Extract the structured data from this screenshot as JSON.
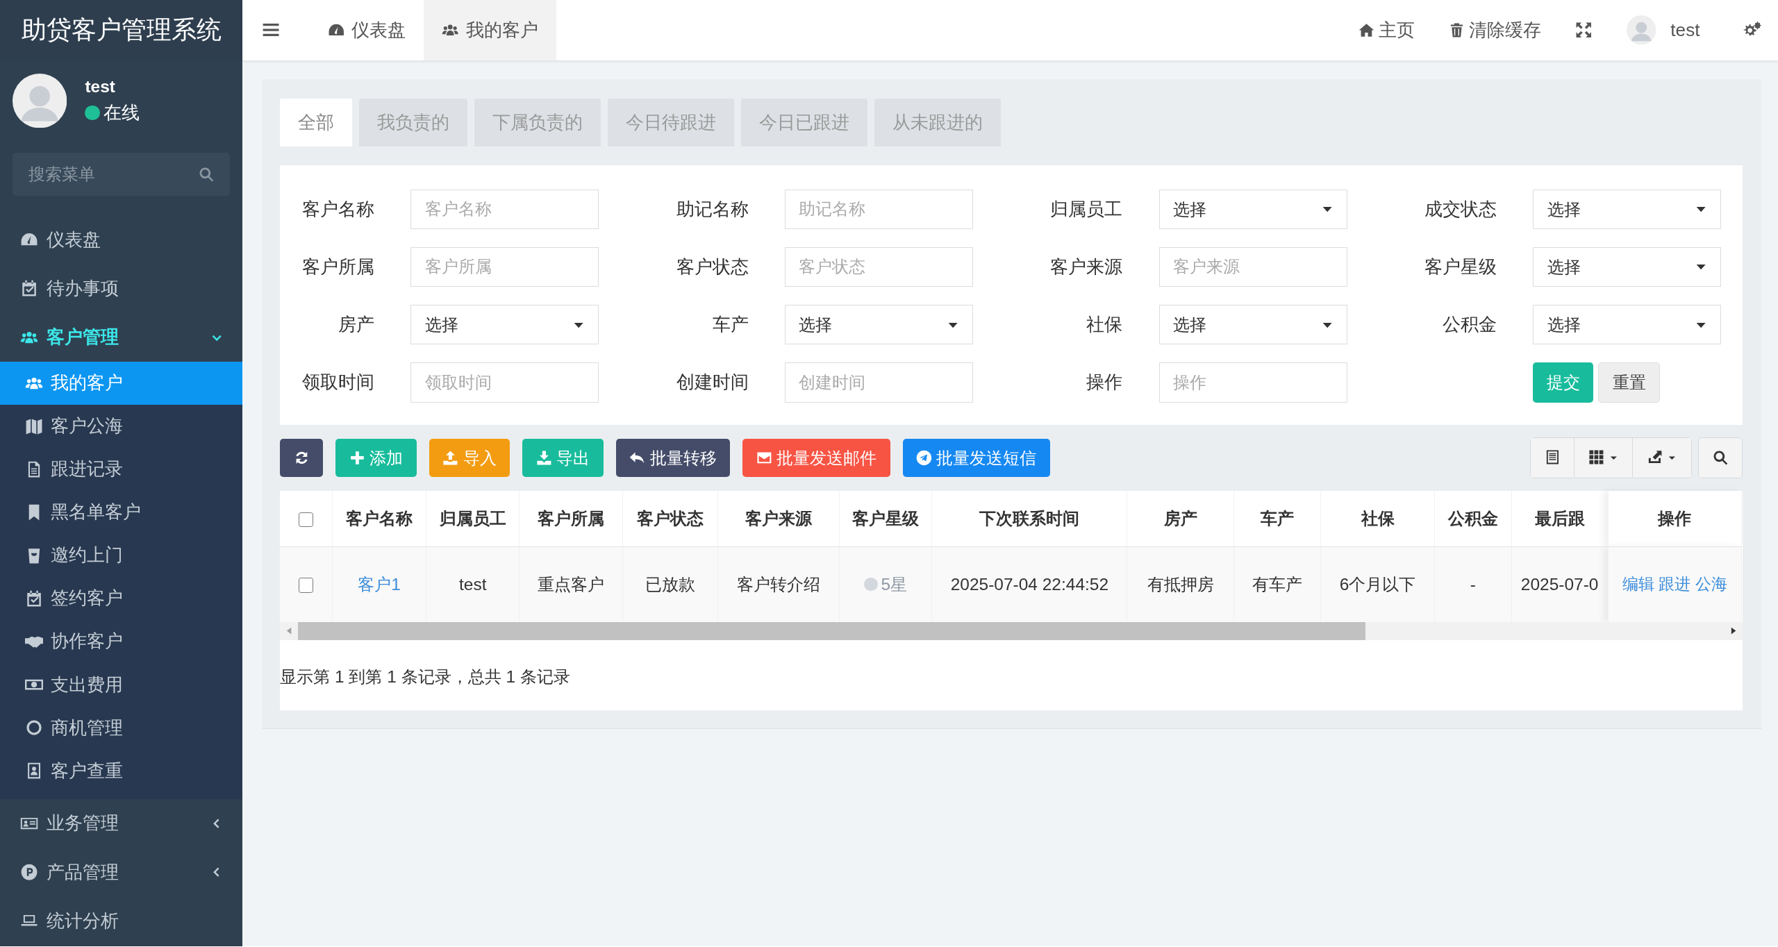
{
  "app_title": "助贷客户管理系统",
  "user": {
    "name": "test",
    "status": "在线",
    "online": true
  },
  "sidebar": {
    "search_placeholder": "搜索菜单",
    "items": [
      {
        "label": "仪表盘",
        "selected": false
      },
      {
        "label": "待办事项",
        "selected": false
      },
      {
        "label": "客户管理",
        "selected": true,
        "expanded": true,
        "children": [
          {
            "label": "我的客户",
            "selected": true
          },
          {
            "label": "客户公海",
            "selected": false
          },
          {
            "label": "跟进记录",
            "selected": false
          },
          {
            "label": "黑名单客户",
            "selected": false
          },
          {
            "label": "邀约上门",
            "selected": false
          },
          {
            "label": "签约客户",
            "selected": false
          },
          {
            "label": "协作客户",
            "selected": false
          },
          {
            "label": "支出费用",
            "selected": false
          },
          {
            "label": "商机管理",
            "selected": false
          },
          {
            "label": "客户查重",
            "selected": false
          }
        ]
      },
      {
        "label": "业务管理",
        "selected": false,
        "expanded": false
      },
      {
        "label": "产品管理",
        "selected": false,
        "expanded": false
      },
      {
        "label": "统计分析",
        "selected": false
      }
    ]
  },
  "topbar": {
    "tabs": [
      {
        "label": "仪表盘",
        "selected": false
      },
      {
        "label": "我的客户",
        "selected": true
      }
    ],
    "links": [
      "主页",
      "清除缓存"
    ],
    "user": "test"
  },
  "filter_tabs": [
    {
      "label": "全部",
      "selected": true
    },
    {
      "label": "我负责的",
      "selected": false
    },
    {
      "label": "下属负责的",
      "selected": false
    },
    {
      "label": "今日待跟进",
      "selected": false
    },
    {
      "label": "今日已跟进",
      "selected": false
    },
    {
      "label": "从未跟进的",
      "selected": false
    }
  ],
  "form": {
    "fields": [
      {
        "label": "客户名称",
        "kind": "input",
        "placeholder": "客户名称"
      },
      {
        "label": "助记名称",
        "kind": "input",
        "placeholder": "助记名称"
      },
      {
        "label": "归属员工",
        "kind": "select",
        "value": "选择"
      },
      {
        "label": "成交状态",
        "kind": "select",
        "value": "选择"
      },
      {
        "label": "客户所属",
        "kind": "input",
        "placeholder": "客户所属"
      },
      {
        "label": "客户状态",
        "kind": "input",
        "placeholder": "客户状态"
      },
      {
        "label": "客户来源",
        "kind": "input",
        "placeholder": "客户来源"
      },
      {
        "label": "客户星级",
        "kind": "select",
        "value": "选择"
      },
      {
        "label": "房产",
        "kind": "select",
        "value": "选择"
      },
      {
        "label": "车产",
        "kind": "select",
        "value": "选择"
      },
      {
        "label": "社保",
        "kind": "select",
        "value": "选择"
      },
      {
        "label": "公积金",
        "kind": "select",
        "value": "选择"
      },
      {
        "label": "领取时间",
        "kind": "input",
        "placeholder": "领取时间"
      },
      {
        "label": "创建时间",
        "kind": "input",
        "placeholder": "创建时间"
      },
      {
        "label": "操作",
        "kind": "input",
        "placeholder": "操作"
      }
    ],
    "buttons": [
      {
        "label": "提交",
        "kind": "primary"
      },
      {
        "label": "重置",
        "kind": "default"
      }
    ]
  },
  "toolbar": [
    {
      "kind": "refresh",
      "color": "#444c69"
    },
    {
      "kind": "add",
      "label": "添加",
      "color": "#18bc9c"
    },
    {
      "kind": "import",
      "label": "导入",
      "color": "#f39c12"
    },
    {
      "kind": "export",
      "label": "导出",
      "color": "#18bc9c"
    },
    {
      "kind": "transfer",
      "label": "批量转移",
      "color": "#444c69"
    },
    {
      "kind": "mail",
      "label": "批量发送邮件",
      "color": "#f75444"
    },
    {
      "kind": "sms",
      "label": "批量发送短信",
      "color": "#1688f1"
    }
  ],
  "table": {
    "select_all": {
      "checked": false
    },
    "columns": [
      "客户名称",
      "归属员工",
      "客户所属",
      "客户状态",
      "客户来源",
      "客户星级",
      "下次联系时间",
      "房产",
      "车产",
      "社保",
      "公积金",
      "最后跟",
      "操作"
    ],
    "rows": [
      {
        "checked": false,
        "cells": [
          {
            "kind": "link",
            "text": "客户1"
          },
          {
            "kind": "text",
            "text": "test"
          },
          {
            "kind": "text",
            "text": "重点客户"
          },
          {
            "kind": "text",
            "text": "已放款"
          },
          {
            "kind": "text",
            "text": "客户转介绍"
          },
          {
            "kind": "badge",
            "text": "5星"
          },
          {
            "kind": "text",
            "text": "2025-07-04 22:44:52"
          },
          {
            "kind": "text",
            "text": "有抵押房"
          },
          {
            "kind": "text",
            "text": "有车产"
          },
          {
            "kind": "text",
            "text": "6个月以下"
          },
          {
            "kind": "text",
            "text": "-"
          },
          {
            "kind": "text",
            "text": "2025-07-0"
          }
        ],
        "actions": [
          "编辑",
          "跟进",
          "公海"
        ]
      }
    ]
  },
  "footer": "显示第 1 到第 1 条记录，总共 1 条记录"
}
